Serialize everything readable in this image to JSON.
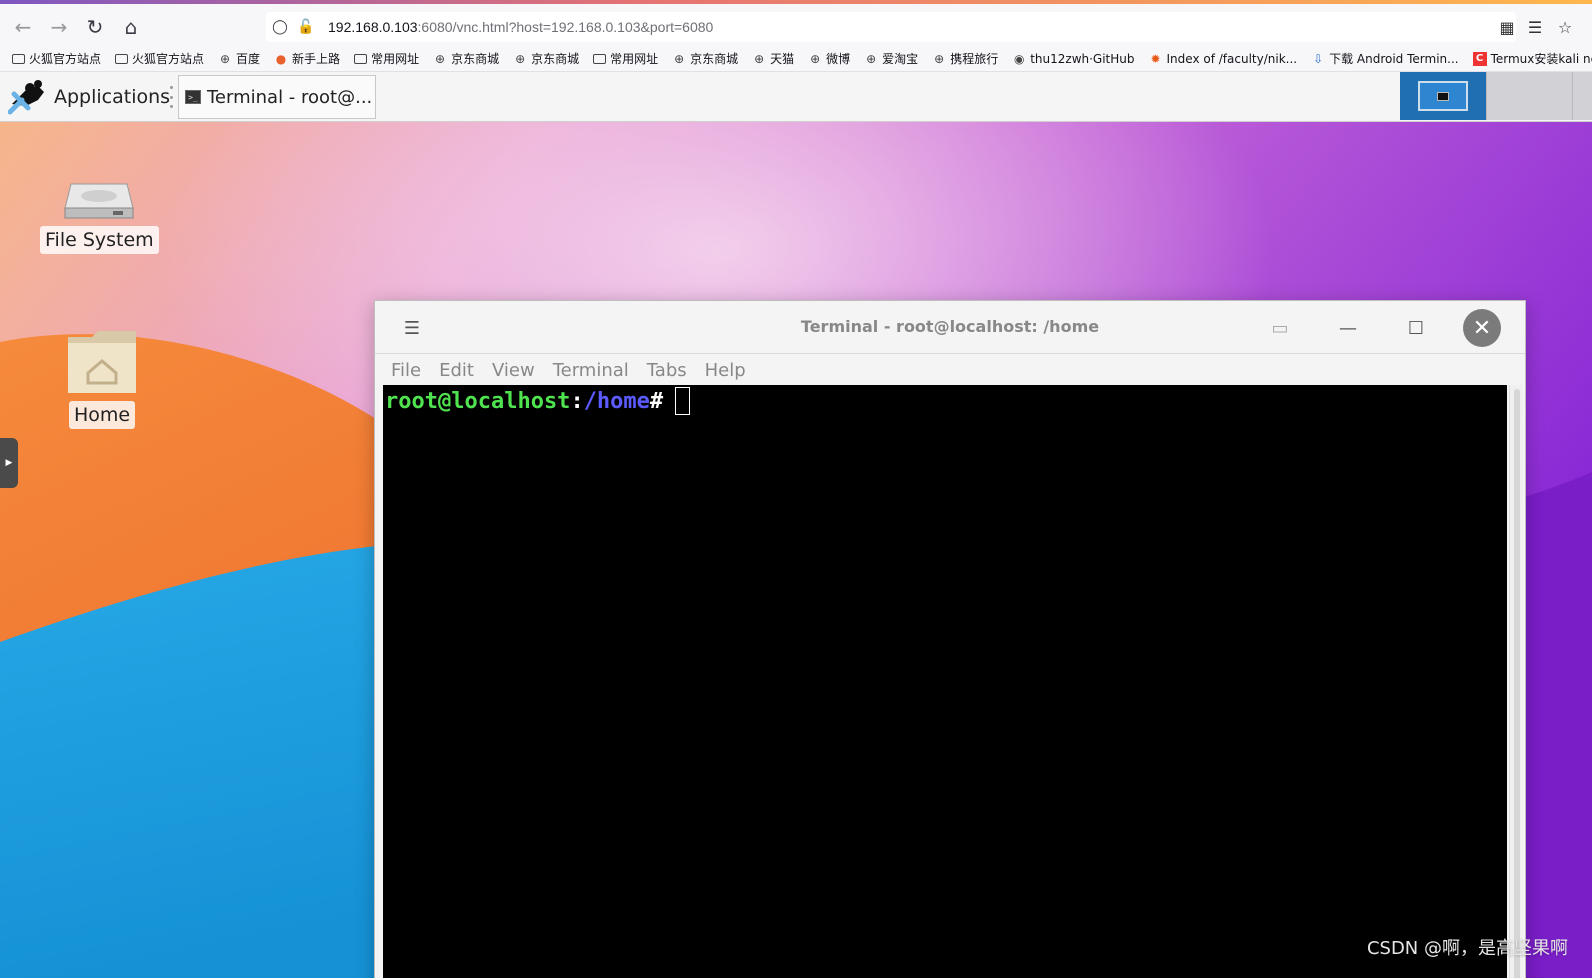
{
  "browser": {
    "url_host": "192.168.0.103",
    "url_rest": ":6080/vnc.html?host=192.168.0.103&port=6080"
  },
  "bookmarks": [
    {
      "label": "火狐官方站点",
      "icon": "folder-icon"
    },
    {
      "label": "火狐官方站点",
      "icon": "folder-icon"
    },
    {
      "label": "百度",
      "icon": "globe-icon"
    },
    {
      "label": "新手上路",
      "icon": "firefox-icon"
    },
    {
      "label": "常用网址",
      "icon": "folder-icon"
    },
    {
      "label": "京东商城",
      "icon": "globe-icon"
    },
    {
      "label": "京东商城",
      "icon": "globe-icon"
    },
    {
      "label": "常用网址",
      "icon": "folder-icon"
    },
    {
      "label": "京东商城",
      "icon": "globe-icon"
    },
    {
      "label": "天猫",
      "icon": "globe-icon"
    },
    {
      "label": "微博",
      "icon": "globe-icon"
    },
    {
      "label": "爱淘宝",
      "icon": "globe-icon"
    },
    {
      "label": "携程旅行",
      "icon": "globe-icon"
    },
    {
      "label": "thu12zwh·GitHub",
      "icon": "github-icon"
    },
    {
      "label": "Index of /faculty/nik...",
      "icon": "fire-icon"
    },
    {
      "label": "下载 Android Termin...",
      "icon": "download-icon"
    },
    {
      "label": "Termux安装kali ne",
      "icon": "csdn-icon"
    }
  ],
  "panel": {
    "applications_label": "Applications",
    "task_label": "Terminal - root@..."
  },
  "desktop": {
    "icons": [
      {
        "label": "File System"
      },
      {
        "label": "Home"
      }
    ]
  },
  "terminal": {
    "title": "Terminal - root@localhost: /home",
    "menu": [
      "File",
      "Edit",
      "View",
      "Terminal",
      "Tabs",
      "Help"
    ],
    "prompt_user": "root@localhost",
    "prompt_colon": ":",
    "prompt_path": "/home",
    "prompt_hash": "#"
  },
  "watermark": "CSDN @啊，是高坚果啊",
  "colors": {
    "prompt_user": "#4fe34f",
    "prompt_path": "#5b5bff",
    "workspace_active": "#1f6fb2"
  }
}
